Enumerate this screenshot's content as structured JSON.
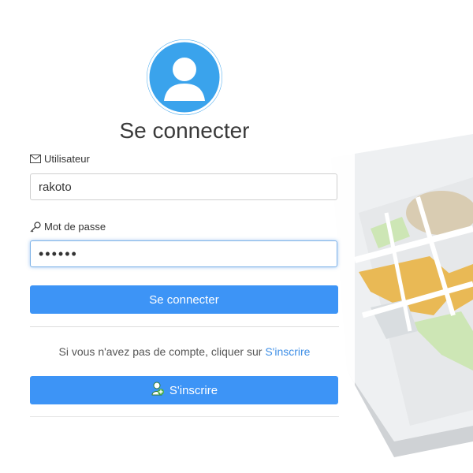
{
  "title": "Se connecter",
  "username": {
    "label": "Utilisateur",
    "value": "rakoto",
    "label_icon": "envelope-icon"
  },
  "password": {
    "label": "Mot de passe",
    "value": "••••••",
    "label_icon": "key-icon"
  },
  "login_button": {
    "label": "Se connecter"
  },
  "signup": {
    "prompt": "Si vous n'avez pas de compte, cliquer sur",
    "link_label": "S'inscrire",
    "button_label": "S'inscrire",
    "button_icon": "user-add-icon"
  },
  "colors": {
    "accent": "#3d94f6",
    "avatar_bg": "#3aa3ec",
    "link": "#3d8ee6"
  }
}
